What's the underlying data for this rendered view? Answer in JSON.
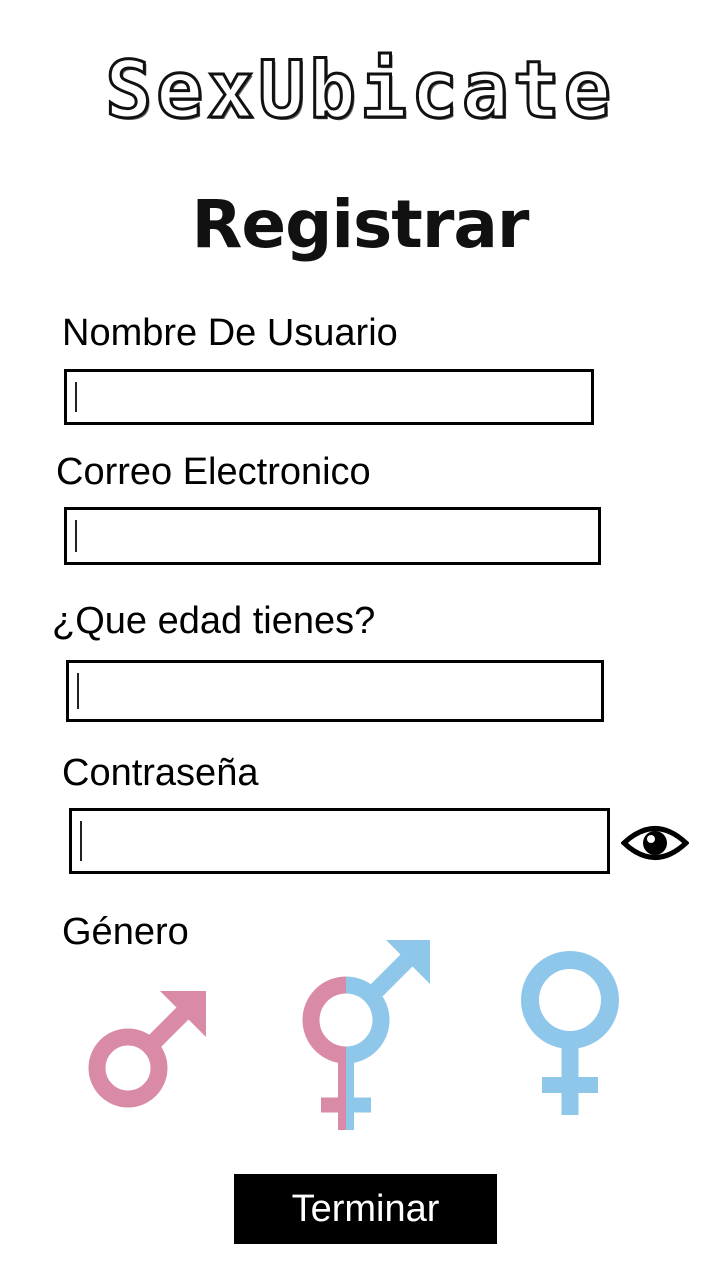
{
  "app": {
    "title": "SexUbicate"
  },
  "page": {
    "heading": "Registrar"
  },
  "form": {
    "username": {
      "label": "Nombre De Usuario",
      "value": ""
    },
    "email": {
      "label": "Correo Electronico",
      "value": ""
    },
    "age": {
      "label": "¿Que edad tienes?",
      "value": ""
    },
    "password": {
      "label": "Contraseña",
      "value": "",
      "toggle_icon": "eye-icon"
    },
    "gender": {
      "label": "Género",
      "options": [
        {
          "icon": "male-symbol-icon",
          "color": "#d98aa6"
        },
        {
          "icon": "intersex-symbol-icon",
          "colors": [
            "#d98aa6",
            "#8ec7ea"
          ]
        },
        {
          "icon": "female-symbol-icon",
          "color": "#8ec7ea"
        }
      ]
    }
  },
  "actions": {
    "submit_label": "Terminar"
  },
  "colors": {
    "pink": "#d98aa6",
    "blue": "#8ec7ea",
    "button_bg": "#000000",
    "button_text": "#ffffff"
  }
}
